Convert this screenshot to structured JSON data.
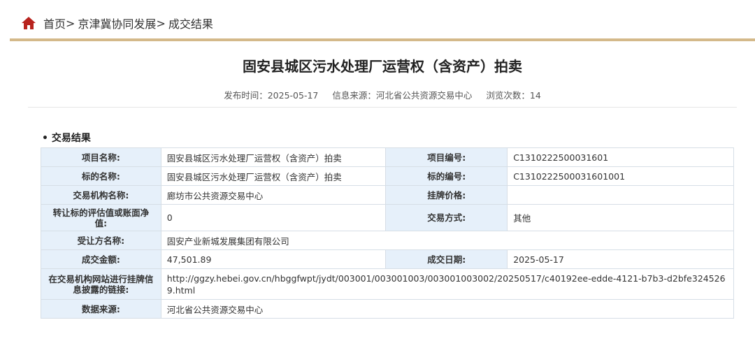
{
  "breadcrumb": {
    "items": [
      "首页",
      "京津冀协同发展",
      "成交结果"
    ],
    "separator": ">"
  },
  "colors": {
    "home_icon": "#b8231e",
    "accent_rule": "#d4b98a",
    "label_bg": "#e6f0fa"
  },
  "article": {
    "title": "固安县城区污水处理厂运营权（含资产）拍卖",
    "publish_label": "发布时间：",
    "publish_date": "2025-05-17",
    "source_label": "信息来源：",
    "source": "河北省公共资源交易中心",
    "views_label": "浏览次数：",
    "views": "14"
  },
  "section": {
    "title": "交易结果"
  },
  "table": {
    "project_name_label": "项目名称:",
    "project_name": "固安县城区污水处理厂运营权（含资产）拍卖",
    "project_no_label": "项目编号:",
    "project_no": "C1310222500031601",
    "subject_name_label": "标的名称:",
    "subject_name": "固安县城区污水处理厂运营权（含资产）拍卖",
    "subject_no_label": "标的编号:",
    "subject_no": "C1310222500031601001",
    "agency_label": "交易机构名称:",
    "agency": "廊坊市公共资源交易中心",
    "list_price_label": "挂牌价格:",
    "list_price": "",
    "valuation_label": "转让标的评估值或账面净值:",
    "valuation": "0",
    "method_label": "交易方式:",
    "method": "其他",
    "buyer_label": "受让方名称:",
    "buyer": "固安产业新城发展集团有限公司",
    "amount_label": "成交金额:",
    "amount": "47,501.89",
    "deal_date_label": "成交日期:",
    "deal_date": "2025-05-17",
    "link_label": "在交易机构网站进行挂牌信息披露的链接:",
    "link": "http://ggzy.hebei.gov.cn/hbggfwpt/jydt/003001/003001003/003001003002/20250517/c40192ee-edde-4121-b7b3-d2bfe3245269.html",
    "data_source_label": "数据来源:",
    "data_source": "河北省公共资源交易中心"
  }
}
